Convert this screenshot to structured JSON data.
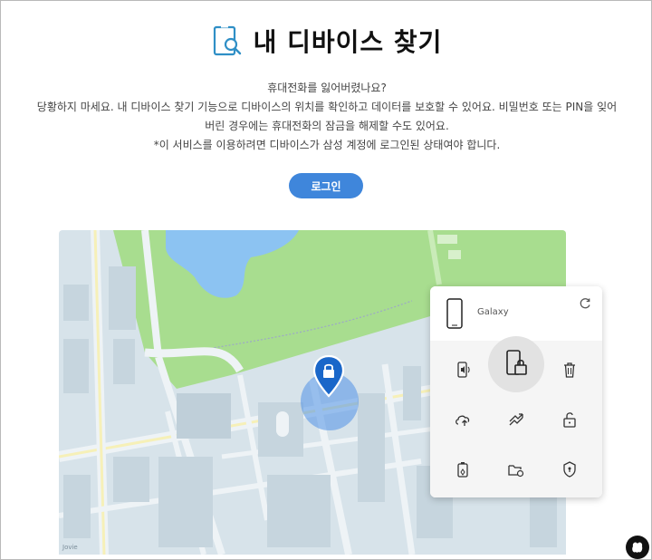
{
  "header": {
    "title": "내 디바이스 찾기",
    "title_icon": "find-device-icon"
  },
  "description": {
    "line1": "휴대전화를 잃어버렸나요?",
    "line2": "당황하지 마세요. 내 디바이스 찾기 기능으로 디바이스의 위치를 확인하고 데이터를 보호할 수 있어요. 비밀번호 또는 PIN을 잊어",
    "line3": "버린 경우에는 휴대전화의 잠금을 해제할 수도 있어요.",
    "line4": "*이 서비스를 이용하려면 디바이스가 삼성 계정에 로그인된 상태여야 합니다."
  },
  "login_button": {
    "label": "로그인"
  },
  "map": {
    "credit": "Jovie",
    "colors": {
      "park": "#a8dd8f",
      "lake": "#8cc3f2",
      "blocks": "#d7e3ea",
      "roads": "#eef3f6",
      "building": "#c6d5de"
    }
  },
  "device_panel": {
    "device_name": "Galaxy",
    "actions": [
      {
        "name": "ring-icon"
      },
      {
        "name": "lock-icon"
      },
      {
        "name": "erase-icon"
      },
      {
        "name": "backup-icon"
      },
      {
        "name": "track-icon"
      },
      {
        "name": "unlock-icon"
      },
      {
        "name": "battery-icon"
      },
      {
        "name": "retrieve-icon"
      },
      {
        "name": "guardian-icon"
      }
    ]
  },
  "colors": {
    "accent": "#3f86db",
    "pin": "#1a67c9"
  }
}
